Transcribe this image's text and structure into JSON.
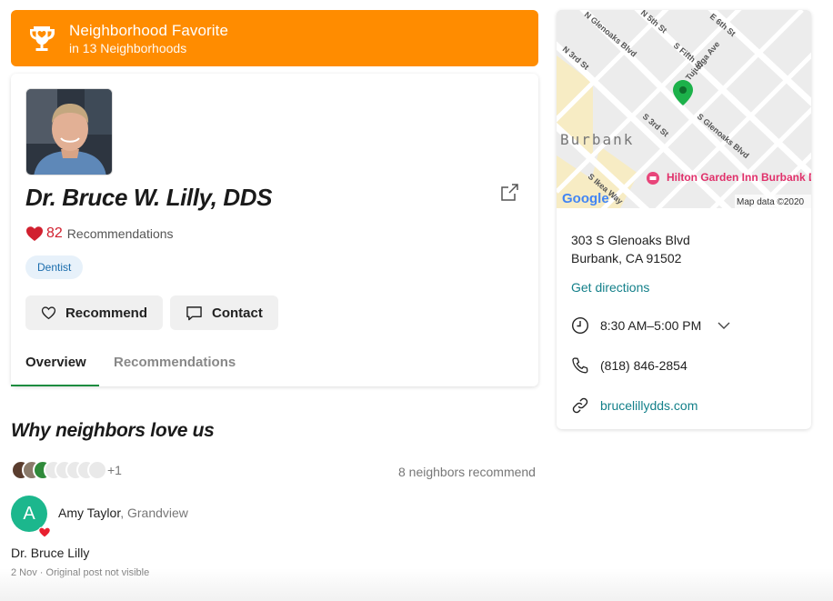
{
  "banner": {
    "title": "Neighborhood Favorite",
    "subtitle": "in 13 Neighborhoods",
    "color": "#ff8c00"
  },
  "profile": {
    "name": "Dr. Bruce W. Lilly, DDS",
    "rec_count": "82",
    "rec_label": "Recommendations",
    "category": "Dentist"
  },
  "actions": {
    "recommend": "Recommend",
    "contact": "Contact"
  },
  "tabs": [
    {
      "label": "Overview",
      "active": true
    },
    {
      "label": "Recommendations",
      "active": false
    }
  ],
  "why": {
    "heading": "Why neighbors love us",
    "more_count": "+1",
    "neighbors_recommend": "8 neighbors recommend"
  },
  "post": {
    "avatar_letter": "A",
    "author": "Amy Taylor",
    "location": ", Grandview",
    "body": "Dr. Bruce Lilly",
    "meta": "2 Nov · Original post not visible"
  },
  "map": {
    "streets": [
      "N Glenoaks Blvd",
      "N 3rd St",
      "S 3rd St",
      "S Glenoaks Blvd",
      "S Fifth St",
      "E 6th St",
      "N 5th St",
      "Tujunga Ave",
      "S Ikea Way"
    ],
    "city": "Burbank",
    "poi": "Hilton Garden Inn Burbank Downtown",
    "logo": "Google",
    "attribution": "Map data ©2020"
  },
  "business": {
    "address_line1": "303 S Glenoaks Blvd",
    "address_line2": "Burbank, CA 91502",
    "directions": "Get directions",
    "hours": "8:30 AM–5:00 PM",
    "phone": "(818) 846-2854",
    "website": "brucelillydds.com"
  },
  "colors": {
    "accent_green": "#1d8c3f",
    "link_teal": "#14808a",
    "heart_red": "#d1202f",
    "tag_blue": "#1b6dad"
  }
}
